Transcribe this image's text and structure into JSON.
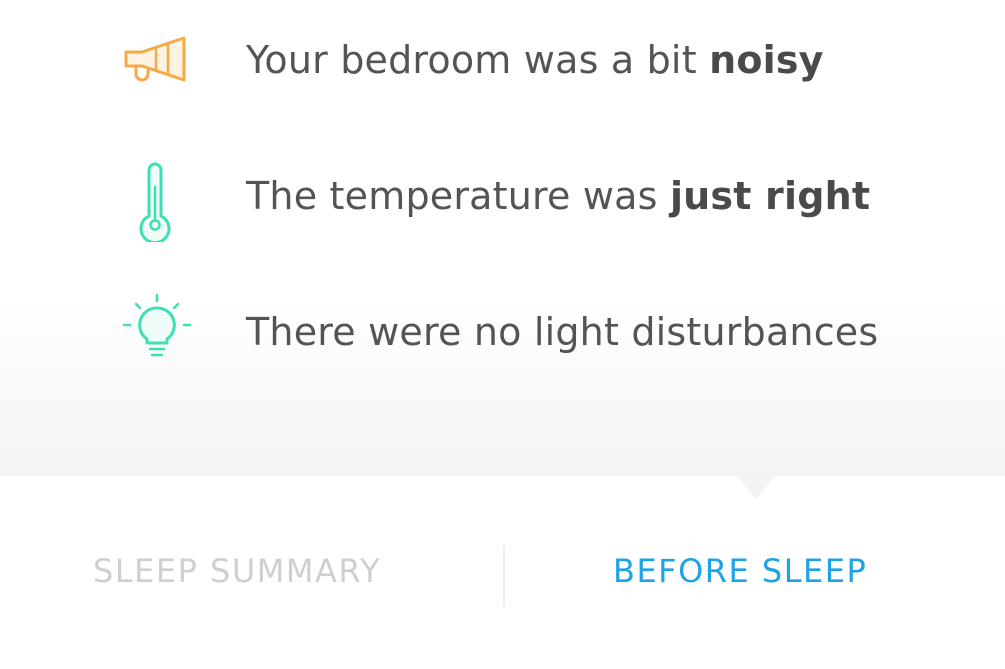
{
  "insights": [
    {
      "icon": "megaphone-icon",
      "color": "#f5a947",
      "text_prefix": "Your bedroom was a bit ",
      "text_bold": "noisy"
    },
    {
      "icon": "thermometer-icon",
      "color": "#3ddfb6",
      "text_prefix": "The temperature was ",
      "text_bold": "just right"
    },
    {
      "icon": "lightbulb-icon",
      "color": "#3ddfb6",
      "text_prefix": "There were no light disturbances",
      "text_bold": ""
    }
  ],
  "tabs": {
    "summary_label": "SLEEP SUMMARY",
    "before_label": "BEFORE SLEEP",
    "active": "before",
    "active_color": "#1fa3e8",
    "inactive_color": "#cfcfcf"
  }
}
